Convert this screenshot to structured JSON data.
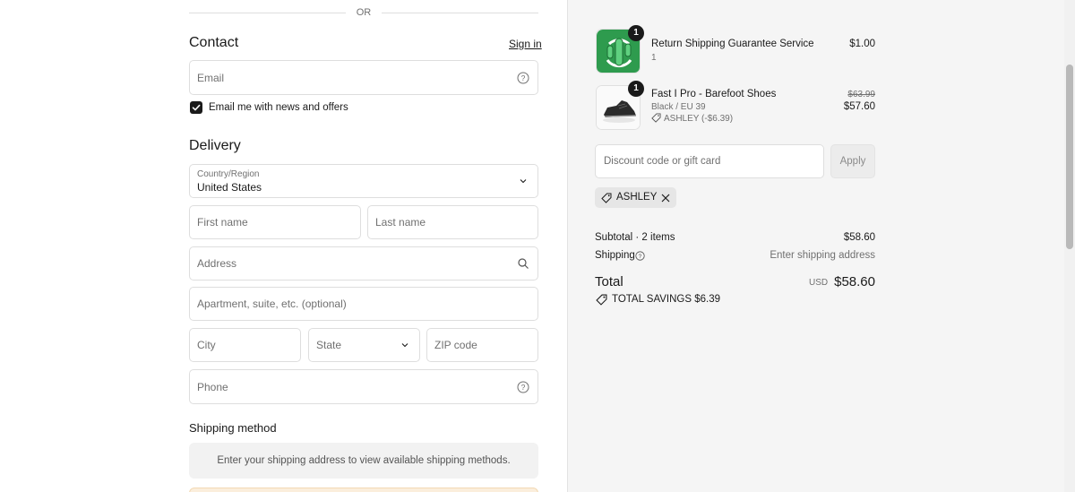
{
  "left": {
    "or_text": "OR",
    "contact": {
      "heading": "Contact",
      "sign_in": "Sign in",
      "email_placeholder": "Email",
      "newsletter_label": "Email me with news and offers",
      "newsletter_checked": true
    },
    "delivery": {
      "heading": "Delivery",
      "country_label": "Country/Region",
      "country_value": "United States",
      "first_name": "First name",
      "last_name": "Last name",
      "address": "Address",
      "apartment": "Apartment, suite, etc. (optional)",
      "city": "City",
      "state": "State",
      "zip": "ZIP code",
      "phone": "Phone"
    },
    "shipping_method": {
      "heading": "Shipping method",
      "message": "Enter your shipping address to view available shipping methods."
    }
  },
  "summary": {
    "items": [
      {
        "title": "Return Shipping Guarantee Service",
        "subtitle": "1",
        "quantity": "1",
        "price": "$1.00",
        "icon": "cactus-app-icon"
      },
      {
        "title": "Fast I Pro - Barefoot Shoes",
        "variant": "Black / EU 39",
        "discount": "ASHLEY (-$6.39)",
        "quantity": "1",
        "original_price": "$63.99",
        "price": "$57.60",
        "icon": "shoe-image"
      }
    ],
    "discount_placeholder": "Discount code or gift card",
    "apply_label": "Apply",
    "applied_code": "ASHLEY",
    "subtotal_label": "Subtotal · 2 items",
    "subtotal_value": "$58.60",
    "shipping_label": "Shipping",
    "shipping_value": "Enter shipping address",
    "total_label": "Total",
    "currency": "USD",
    "total_value": "$58.60",
    "savings": "TOTAL SAVINGS  $6.39"
  },
  "colors": {
    "accent": "#1a1a1a",
    "summary_bg": "#f5f5f5",
    "app_icon_green": "#2e9b4e"
  }
}
